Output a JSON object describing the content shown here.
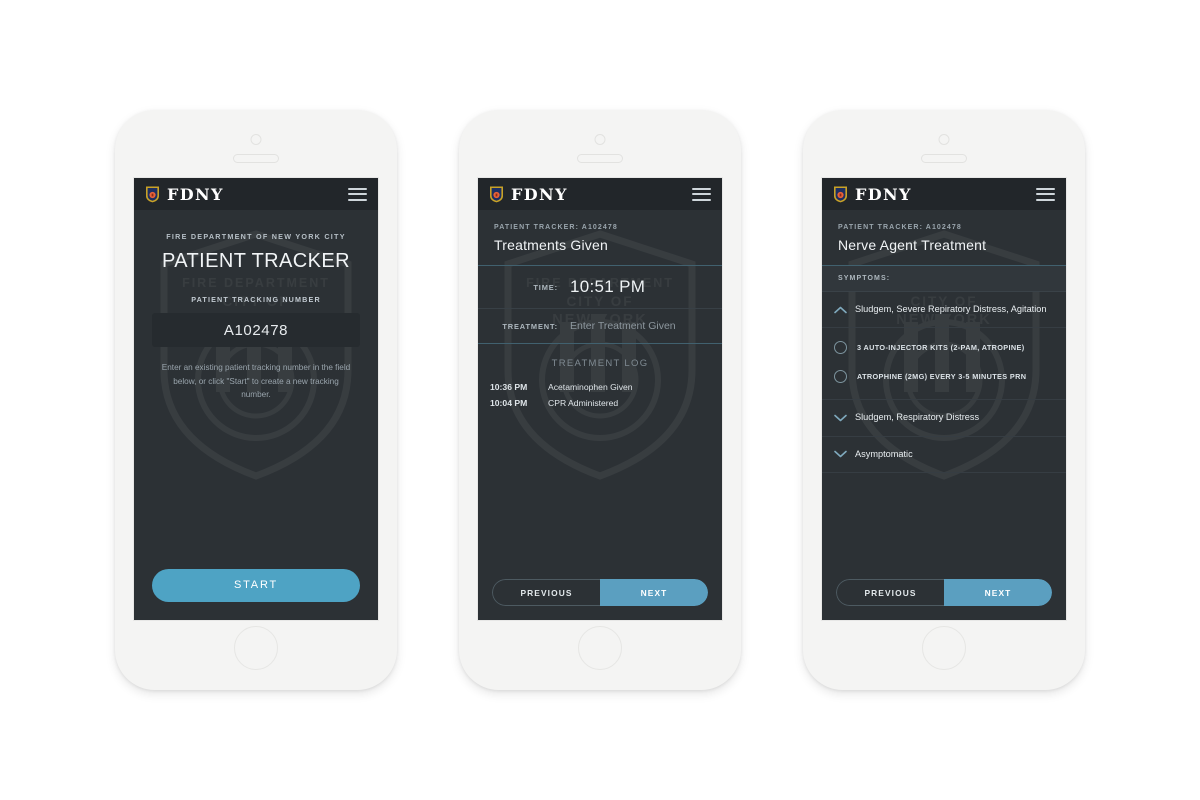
{
  "accent_color": "#4ea3c4",
  "screen_bg": "#2c3135",
  "header_bg": "#22262a",
  "brand": {
    "name": "FDNY",
    "logo_icon": "fdny-badge-icon",
    "menu_icon": "hamburger-menu-icon"
  },
  "watermark": {
    "line1": "FIRE DEPARTMENT",
    "line2": "CITY OF",
    "line3": "NEW YORK"
  },
  "screen1": {
    "dept_line": "FIRE DEPARTMENT OF NEW YORK CITY",
    "title": "PATIENT TRACKER",
    "field_label": "PATIENT TRACKING NUMBER",
    "tracking_value": "A102478",
    "tracking_placeholder": "A102478",
    "help_text": "Enter an existing patient tracking number in the field below, or click \"Start\" to create a new tracking number.",
    "start_label": "START"
  },
  "screen2": {
    "kicker": "PATIENT TRACKER: A102478",
    "title": "Treatments Given",
    "time_label": "TIME:",
    "time_value": "10:51 PM",
    "treatment_label": "TREATMENT:",
    "treatment_placeholder": "Enter Treatment Given",
    "log_title": "TREATMENT LOG",
    "log": [
      {
        "time": "10:36 PM",
        "desc": "Acetaminophen Given"
      },
      {
        "time": "10:04 PM",
        "desc": "CPR Administered"
      }
    ],
    "previous_label": "PREVIOUS",
    "next_label": "NEXT"
  },
  "screen3": {
    "kicker": "PATIENT TRACKER: A102478",
    "title": "Nerve Agent Treatment",
    "symptoms_label": "SYMPTOMS:",
    "items": [
      {
        "text": "Sludgem, Severe Repiratory Distress, Agitation",
        "state": "expanded",
        "chevron": "chevron-up-icon",
        "options": [
          "3 AUTO-INJECTOR KITS (2-PAM, ATROPINE)",
          "ATROPHINE (2MG) EVERY 3-5 MINUTES PRN"
        ]
      },
      {
        "text": "Sludgem, Respiratory Distress",
        "state": "collapsed",
        "chevron": "chevron-down-icon",
        "options": []
      },
      {
        "text": "Asymptomatic",
        "state": "collapsed",
        "chevron": "chevron-down-icon",
        "options": []
      }
    ],
    "previous_label": "PREVIOUS",
    "next_label": "NEXT"
  }
}
